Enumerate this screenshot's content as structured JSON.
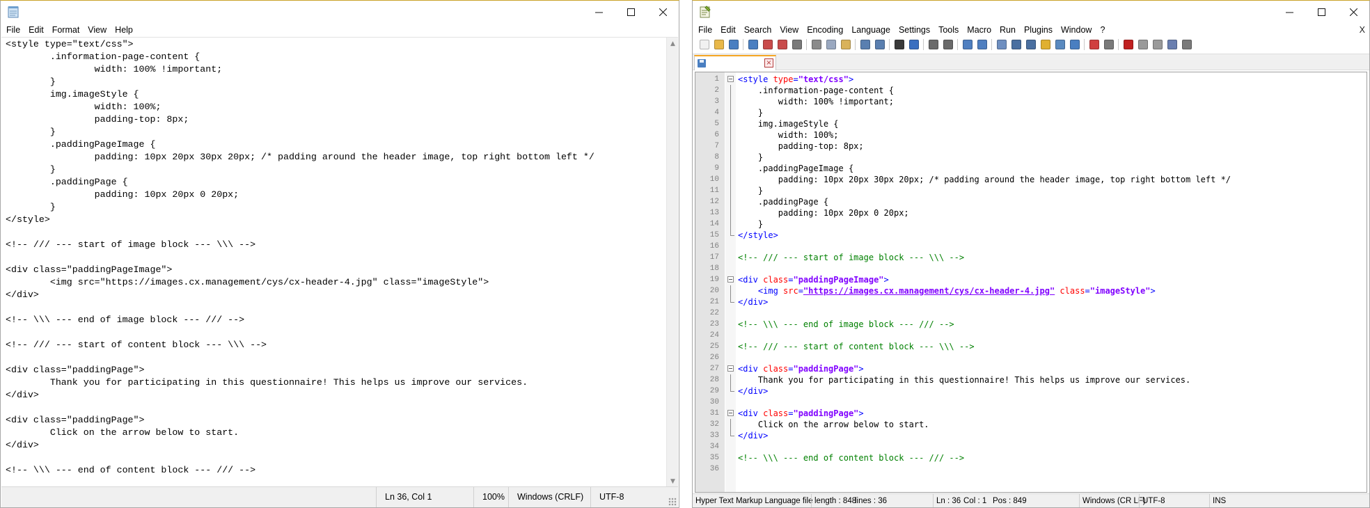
{
  "notepad": {
    "menu": [
      "File",
      "Edit",
      "Format",
      "View",
      "Help"
    ],
    "lines": [
      "<style type=\"text/css\">",
      "\t.information-page-content {",
      "\t\twidth: 100% !important;",
      "\t}",
      "\timg.imageStyle {",
      "\t\twidth: 100%;",
      "\t\tpadding-top: 8px;",
      "\t}",
      "\t.paddingPageImage {",
      "\t\tpadding: 10px 20px 30px 20px; /* padding around the header image, top right bottom left */",
      "\t}",
      "\t.paddingPage {",
      "\t\tpadding: 10px 20px 0 20px;",
      "\t}",
      "</style>",
      "",
      "<!-- /// --- start of image block --- \\\\\\ -->",
      "",
      "<div class=\"paddingPageImage\">",
      "\t<img src=\"https://images.cx.management/cys/cx-header-4.jpg\" class=\"imageStyle\">",
      "</div>",
      "",
      "<!-- \\\\\\ --- end of image block --- /// -->",
      "",
      "<!-- /// --- start of content block --- \\\\\\ -->",
      "",
      "<div class=\"paddingPage\">",
      "\tThank you for participating in this questionnaire! This helps us improve our services.",
      "</div>",
      "",
      "<div class=\"paddingPage\">",
      "\tClick on the arrow below to start.",
      "</div>",
      "",
      "<!-- \\\\\\ --- end of content block --- /// -->"
    ],
    "status": {
      "position": "Ln 36, Col 1",
      "zoom": "100%",
      "line_ending": "Windows (CRLF)",
      "encoding": "UTF-8"
    }
  },
  "notepadpp": {
    "menu": [
      "File",
      "Edit",
      "Search",
      "View",
      "Encoding",
      "Language",
      "Settings",
      "Tools",
      "Macro",
      "Run",
      "Plugins",
      "Window",
      "?"
    ],
    "menu_close": "X",
    "toolbar_icons": [
      "new-file-icon",
      "open-file-icon",
      "save-icon",
      "save-all-icon",
      "close-icon",
      "close-all-icon",
      "print-icon",
      "cut-icon",
      "copy-icon",
      "paste-icon",
      "undo-icon",
      "redo-icon",
      "find-icon",
      "replace-icon",
      "zoom-in-icon",
      "zoom-out-icon",
      "sync-vertical-icon",
      "sync-horizontal-icon",
      "word-wrap-icon",
      "show-all-chars-icon",
      "indent-guide-icon",
      "udl-icon",
      "doc-map-icon",
      "function-list-icon",
      "folder-workspace-icon",
      "monitoring-icon",
      "record-macro-icon",
      "stop-macro-icon",
      "play-macro-icon",
      "run-macro-multiple-icon",
      "save-macro-icon"
    ],
    "status": {
      "file_type": "Hyper Text Markup Language file",
      "length": "length : 848",
      "lines": "lines : 36",
      "ln": "Ln : 36",
      "col": "Col : 1",
      "pos": "Pos : 849",
      "line_ending": "Windows (CR LF)",
      "encoding": "UTF-8",
      "mode": "INS"
    },
    "code": [
      {
        "n": "1",
        "fold": "box",
        "t": [
          [
            "tag",
            "<style "
          ],
          [
            "attr",
            "type"
          ],
          [
            "tag",
            "="
          ],
          [
            "val",
            "\"text/css\""
          ],
          [
            "tag",
            ">"
          ]
        ]
      },
      {
        "n": "2",
        "fold": "vline",
        "t": [
          [
            "plain",
            "    .information-page-content {"
          ]
        ]
      },
      {
        "n": "3",
        "fold": "vline",
        "t": [
          [
            "plain",
            "        width: 100% !important;"
          ]
        ]
      },
      {
        "n": "4",
        "fold": "vline",
        "t": [
          [
            "plain",
            "    }"
          ]
        ]
      },
      {
        "n": "5",
        "fold": "vline",
        "t": [
          [
            "plain",
            "    img.imageStyle {"
          ]
        ]
      },
      {
        "n": "6",
        "fold": "vline",
        "t": [
          [
            "plain",
            "        width: 100%;"
          ]
        ]
      },
      {
        "n": "7",
        "fold": "vline",
        "t": [
          [
            "plain",
            "        padding-top: 8px;"
          ]
        ]
      },
      {
        "n": "8",
        "fold": "vline",
        "t": [
          [
            "plain",
            "    }"
          ]
        ]
      },
      {
        "n": "9",
        "fold": "vline",
        "t": [
          [
            "plain",
            "    .paddingPageImage {"
          ]
        ]
      },
      {
        "n": "10",
        "fold": "vline",
        "t": [
          [
            "plain",
            "        padding: 10px 20px 30px 20px; /* padding around the header image, top right bottom left */"
          ]
        ]
      },
      {
        "n": "11",
        "fold": "vline",
        "t": [
          [
            "plain",
            "    }"
          ]
        ]
      },
      {
        "n": "12",
        "fold": "vline",
        "t": [
          [
            "plain",
            "    .paddingPage {"
          ]
        ]
      },
      {
        "n": "13",
        "fold": "vline",
        "t": [
          [
            "plain",
            "        padding: 10px 20px 0 20px;"
          ]
        ]
      },
      {
        "n": "14",
        "fold": "vline",
        "t": [
          [
            "plain",
            "    }"
          ]
        ]
      },
      {
        "n": "15",
        "fold": "end",
        "t": [
          [
            "tag",
            "</style>"
          ]
        ]
      },
      {
        "n": "16",
        "fold": "",
        "t": []
      },
      {
        "n": "17",
        "fold": "",
        "t": [
          [
            "cmt",
            "<!-- /// --- start of image block --- \\\\\\ -->"
          ]
        ]
      },
      {
        "n": "18",
        "fold": "",
        "t": []
      },
      {
        "n": "19",
        "fold": "box",
        "t": [
          [
            "tag",
            "<div "
          ],
          [
            "attr",
            "class"
          ],
          [
            "tag",
            "="
          ],
          [
            "val",
            "\"paddingPageImage\""
          ],
          [
            "tag",
            ">"
          ]
        ]
      },
      {
        "n": "20",
        "fold": "vline",
        "t": [
          [
            "tag",
            "    <img "
          ],
          [
            "attr",
            "src"
          ],
          [
            "tag",
            "="
          ],
          [
            "url",
            "\"https://images.cx.management/cys/cx-header-4.jpg\""
          ],
          [
            "tag",
            " "
          ],
          [
            "attr",
            "class"
          ],
          [
            "tag",
            "="
          ],
          [
            "val",
            "\"imageStyle\""
          ],
          [
            "tag",
            ">"
          ]
        ]
      },
      {
        "n": "21",
        "fold": "end",
        "t": [
          [
            "tag",
            "</div>"
          ]
        ]
      },
      {
        "n": "22",
        "fold": "",
        "t": []
      },
      {
        "n": "23",
        "fold": "",
        "t": [
          [
            "cmt",
            "<!-- \\\\\\ --- end of image block --- /// -->"
          ]
        ]
      },
      {
        "n": "24",
        "fold": "",
        "t": []
      },
      {
        "n": "25",
        "fold": "",
        "t": [
          [
            "cmt",
            "<!-- /// --- start of content block --- \\\\\\ -->"
          ]
        ]
      },
      {
        "n": "26",
        "fold": "",
        "t": []
      },
      {
        "n": "27",
        "fold": "box",
        "t": [
          [
            "tag",
            "<div "
          ],
          [
            "attr",
            "class"
          ],
          [
            "tag",
            "="
          ],
          [
            "val",
            "\"paddingPage\""
          ],
          [
            "tag",
            ">"
          ]
        ]
      },
      {
        "n": "28",
        "fold": "vline",
        "t": [
          [
            "plain",
            "    Thank you for participating in this questionnaire! This helps us improve our services."
          ]
        ]
      },
      {
        "n": "29",
        "fold": "end",
        "t": [
          [
            "tag",
            "</div>"
          ]
        ]
      },
      {
        "n": "30",
        "fold": "",
        "t": []
      },
      {
        "n": "31",
        "fold": "box",
        "t": [
          [
            "tag",
            "<div "
          ],
          [
            "attr",
            "class"
          ],
          [
            "tag",
            "="
          ],
          [
            "val",
            "\"paddingPage\""
          ],
          [
            "tag",
            ">"
          ]
        ]
      },
      {
        "n": "32",
        "fold": "vline",
        "t": [
          [
            "plain",
            "    Click on the arrow below to start."
          ]
        ]
      },
      {
        "n": "33",
        "fold": "end",
        "t": [
          [
            "tag",
            "</div>"
          ]
        ]
      },
      {
        "n": "34",
        "fold": "",
        "t": []
      },
      {
        "n": "35",
        "fold": "",
        "t": [
          [
            "cmt",
            "<!-- \\\\\\ --- end of content block --- /// -->"
          ]
        ]
      },
      {
        "n": "36",
        "fold": "",
        "t": []
      }
    ]
  }
}
